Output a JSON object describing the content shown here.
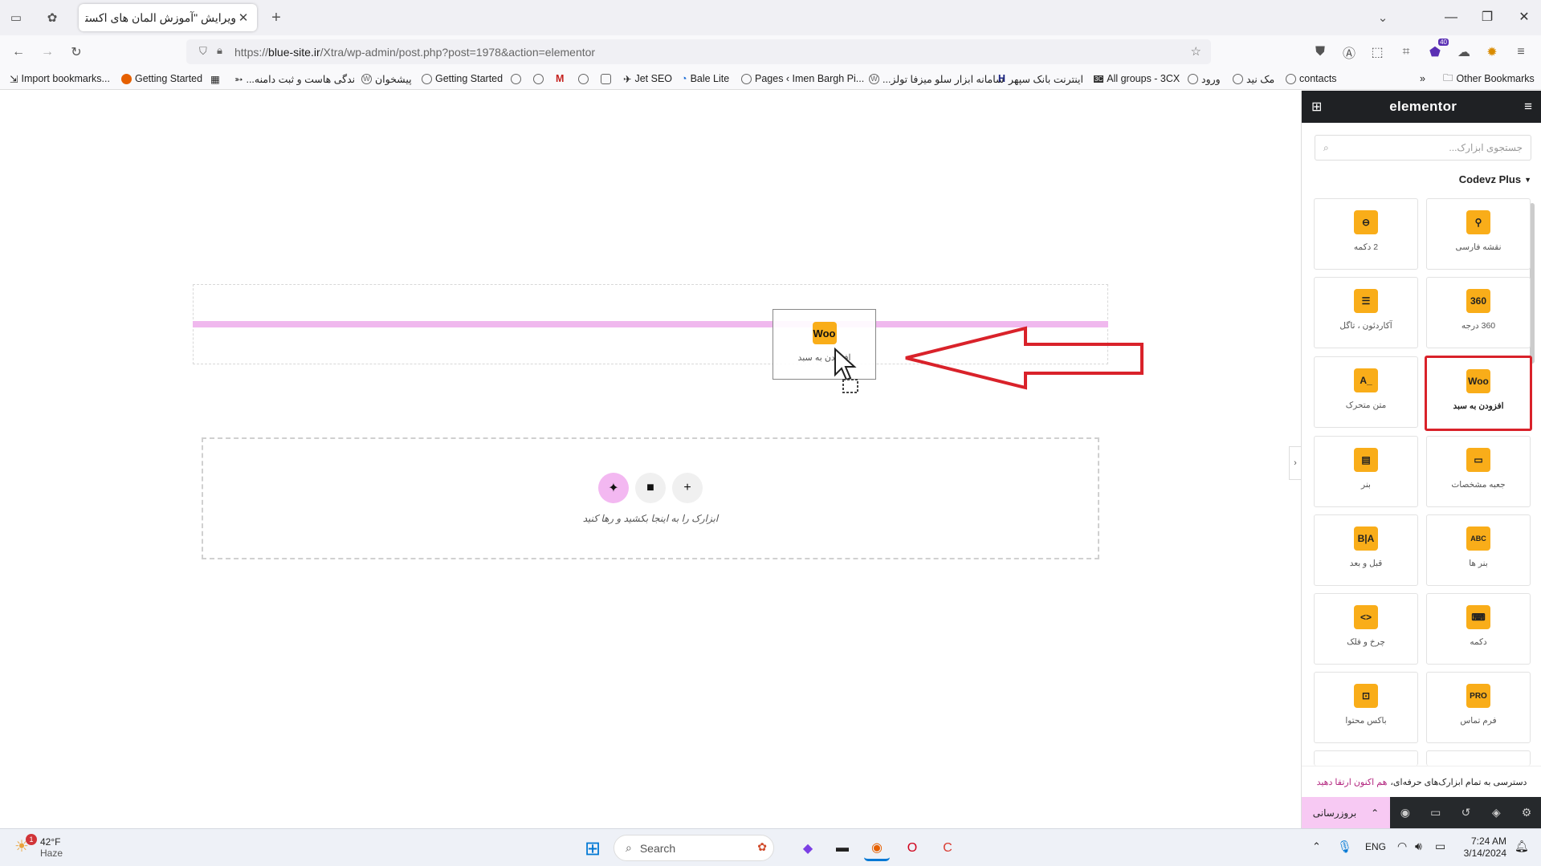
{
  "browser": {
    "tab_title": "ویرایش \"آموزش المان های اکسترا – ‌ع",
    "url_prefix": "https://",
    "url_domain": "blue-site.ir",
    "url_path": "/Xtra/wp-admin/post.php?post=1978&action=elementor",
    "extensions_badge": "40"
  },
  "bookmarks": [
    {
      "label": "Import bookmarks...",
      "icon": "import-icon"
    },
    {
      "label": "Getting Started",
      "icon": "firefox-icon"
    },
    {
      "label": "...ندگی هاست و ثبت دامنه",
      "icon": "arrow-icon"
    },
    {
      "label": "پیشخوان",
      "icon": "wordpress-icon"
    },
    {
      "label": "Getting Started",
      "icon": "globe-icon"
    },
    {
      "label": "Jet SEO",
      "icon": "jet-icon"
    },
    {
      "label": "Bale Lite",
      "icon": "bale-icon"
    },
    {
      "label": "Pages ‹ Imen Bargh Pi...",
      "icon": "globe-icon"
    },
    {
      "label": "...سامانه ابزار سلو میزفا تولز",
      "icon": "wordpress-icon"
    },
    {
      "label": "اینترنت بانک سپهر",
      "icon": "bank-icon"
    },
    {
      "label": "All groups - 3CX",
      "icon": "3cx-icon"
    },
    {
      "label": "ورود",
      "icon": "globe-icon"
    },
    {
      "label": "مک نید",
      "icon": "globe-icon"
    },
    {
      "label": "contacts",
      "icon": "globe-icon"
    },
    {
      "label": "Other Bookmarks",
      "icon": "folder-icon"
    }
  ],
  "canvas": {
    "drag_widget_icon": "Woo",
    "drag_widget_label": "افزودن به سبد",
    "drop_hint": "ابزارک را به اینجا بکشید و رها کنید"
  },
  "panel": {
    "logo": "elementor",
    "search_placeholder": "جستجوی ابزارک...",
    "category": "Codevz Plus",
    "widgets": [
      {
        "icon_text": "⚲",
        "label": "نقشه فارسی"
      },
      {
        "icon_text": "⊖",
        "label": "2 دکمه"
      },
      {
        "icon_text": "360",
        "label": "360 درجه"
      },
      {
        "icon_text": "☰",
        "label": "آکاردئون ، تاگل"
      },
      {
        "icon_text": "Woo",
        "label": "افزودن به سبد"
      },
      {
        "icon_text": "A_",
        "label": "متن متحرک"
      },
      {
        "icon_text": "▭",
        "label": "جعبه مشخصات"
      },
      {
        "icon_text": "▤",
        "label": "بنر"
      },
      {
        "icon_text": "ABC",
        "label": "بنر ها"
      },
      {
        "icon_text": "B|A",
        "label": "قبل و بعد"
      },
      {
        "icon_text": "⌨",
        "label": "دکمه"
      },
      {
        "icon_text": "<>",
        "label": "چرخ و فلک"
      },
      {
        "icon_text": "PRO",
        "label": "فرم تماس"
      },
      {
        "icon_text": "⊡",
        "label": "باکس محتوا"
      }
    ],
    "promo_text": "دسترسی به تمام ابزارک‌های حرفه‌ای،",
    "promo_link": "هم اکنون ارتقا دهید",
    "update_label": "بروزرسانی"
  },
  "taskbar": {
    "weather_temp": "42°F",
    "weather_desc": "Haze",
    "weather_badge": "1",
    "search_placeholder": "Search",
    "lang": "ENG",
    "time": "7:24 AM",
    "date": "3/14/2024"
  },
  "colors": {
    "elementor_dark": "#1f2124",
    "widget_icon_bg": "#f9ad19",
    "highlight_red": "#d9222a",
    "drop_indicator": "#f0b8ee"
  }
}
